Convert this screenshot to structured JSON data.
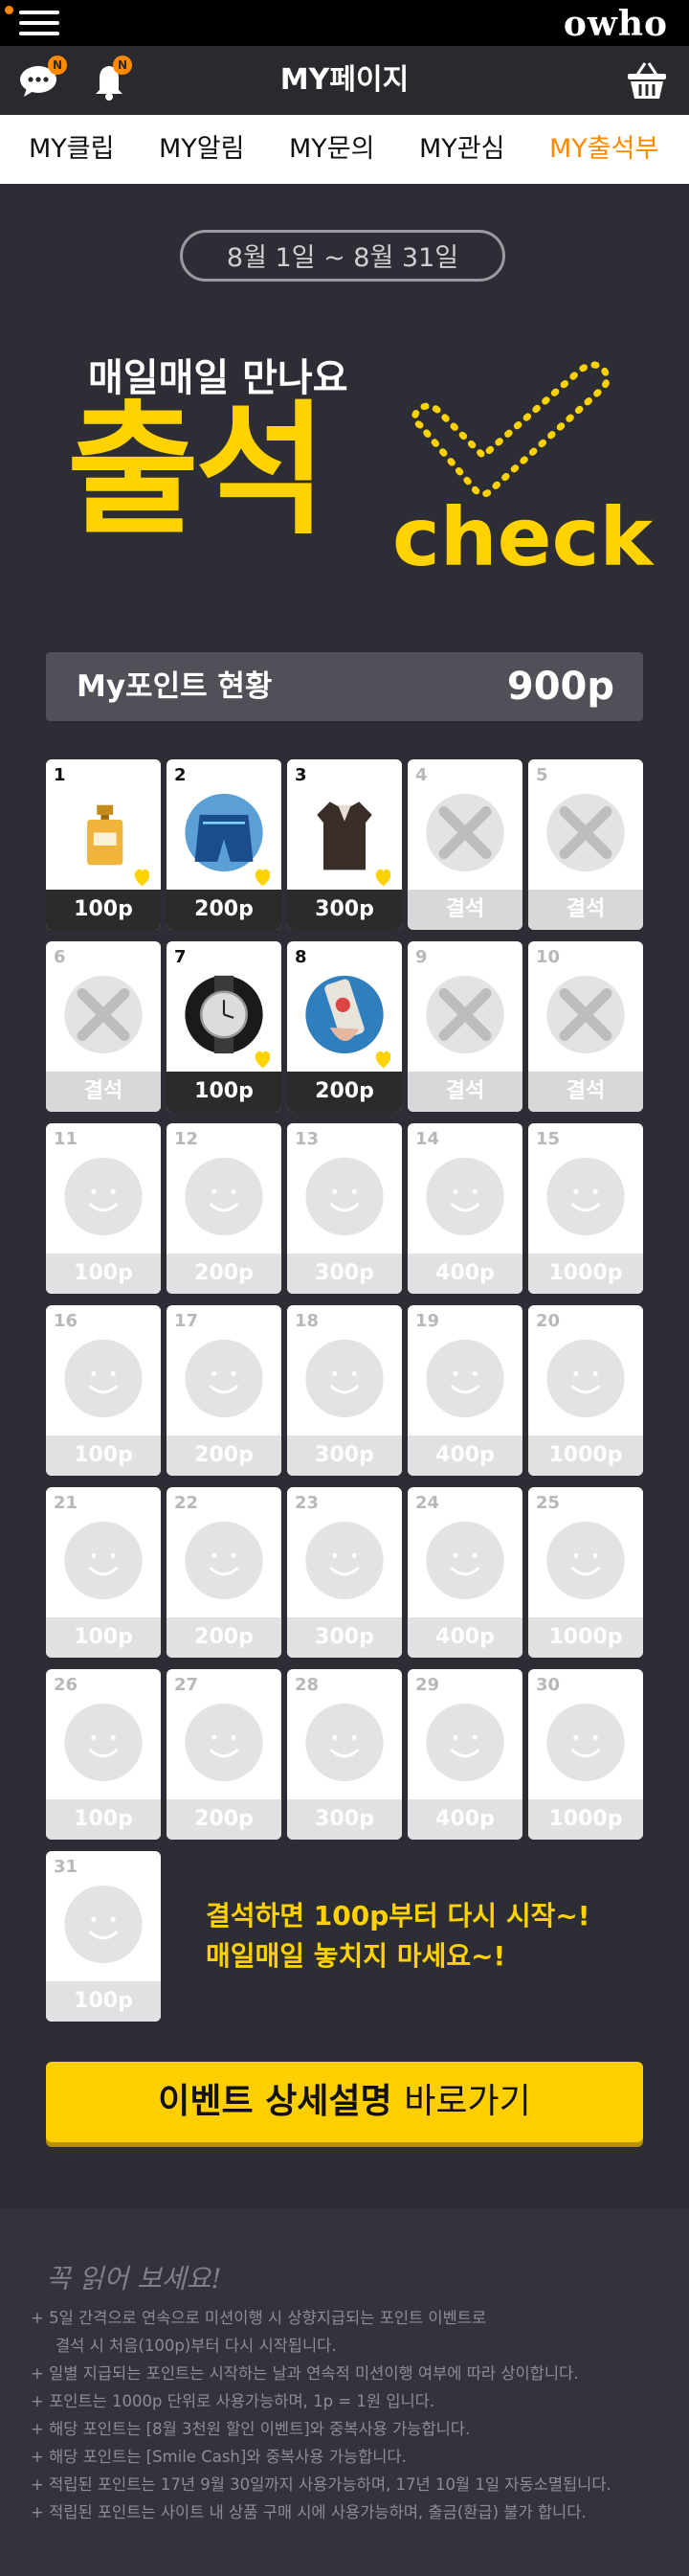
{
  "app": {
    "logo": "owho"
  },
  "header": {
    "title": "MY페이지",
    "chat_badge": "N",
    "bell_badge": "N"
  },
  "tabs": [
    {
      "label": "MY클립"
    },
    {
      "label": "MY알림"
    },
    {
      "label": "MY문의"
    },
    {
      "label": "MY관심"
    },
    {
      "label": "MY출석부",
      "active": true
    }
  ],
  "event": {
    "period": "8월 1일 ~ 8월 31일",
    "subtitle": "매일매일 만나요",
    "headline": "출석",
    "check_word": "check",
    "points_label": "My포인트 현황",
    "points_value": "900p",
    "absent_label": "결석",
    "message_line1": "결석하면 100p부터 다시 시작~!",
    "message_line2": "매일매일 놓치지 마세요~!",
    "detail_button_bold": "이벤트 상세설명",
    "detail_button_rest": "바로가기"
  },
  "colors": {
    "accent": "#ff8a00",
    "yellow": "#ffd200",
    "background": "#2d2e35"
  },
  "days": [
    {
      "n": "1",
      "state": "done",
      "reward": "100p",
      "item": "perfume-bottle"
    },
    {
      "n": "2",
      "state": "done",
      "reward": "200p",
      "item": "swim-shorts"
    },
    {
      "n": "3",
      "state": "done",
      "reward": "300p",
      "item": "black-blouse"
    },
    {
      "n": "4",
      "state": "absent"
    },
    {
      "n": "5",
      "state": "absent"
    },
    {
      "n": "6",
      "state": "absent"
    },
    {
      "n": "7",
      "state": "done",
      "reward": "100p",
      "item": "wristwatch"
    },
    {
      "n": "8",
      "state": "done",
      "reward": "200p",
      "item": "phone-case"
    },
    {
      "n": "9",
      "state": "absent"
    },
    {
      "n": "10",
      "state": "absent"
    },
    {
      "n": "11",
      "reward": "100p"
    },
    {
      "n": "12",
      "reward": "200p"
    },
    {
      "n": "13",
      "reward": "300p"
    },
    {
      "n": "14",
      "reward": "400p"
    },
    {
      "n": "15",
      "reward": "1000p"
    },
    {
      "n": "16",
      "reward": "100p"
    },
    {
      "n": "17",
      "reward": "200p"
    },
    {
      "n": "18",
      "reward": "300p"
    },
    {
      "n": "19",
      "reward": "400p"
    },
    {
      "n": "20",
      "reward": "1000p"
    },
    {
      "n": "21",
      "reward": "100p"
    },
    {
      "n": "22",
      "reward": "200p"
    },
    {
      "n": "23",
      "reward": "300p"
    },
    {
      "n": "24",
      "reward": "400p"
    },
    {
      "n": "25",
      "reward": "1000p"
    },
    {
      "n": "26",
      "reward": "100p"
    },
    {
      "n": "27",
      "reward": "200p"
    },
    {
      "n": "28",
      "reward": "300p"
    },
    {
      "n": "29",
      "reward": "400p"
    },
    {
      "n": "30",
      "reward": "1000p"
    },
    {
      "n": "31",
      "reward": "100p"
    }
  ],
  "notes": {
    "title": "꼭 읽어 보세요!",
    "items": [
      "5일 간격으로 연속으로 미션이행 시 상향지급되는 포인트 이벤트로",
      "결석 시 처음(100p)부터 다시 시작됩니다.",
      "일별 지급되는 포인트는 시작하는 날과 연속적 미션이행 여부에 따라 상이합니다.",
      "포인트는 1000p 단위로 사용가능하며, 1p = 1원 입니다.",
      "해당 포인트는 [8월 3천원 할인 이벤트]와 중복사용 가능합니다.",
      "해당 포인트는 [Smile Cash]와 중복사용 가능합니다.",
      "적립된 포인트는 17년 9월 30일까지 사용가능하며, 17년 10월 1일 자동소멸됩니다.",
      "적립된 포인트는 사이트 내 상품 구매 시에 사용가능하며, 출금(환급) 불가 합니다."
    ]
  }
}
